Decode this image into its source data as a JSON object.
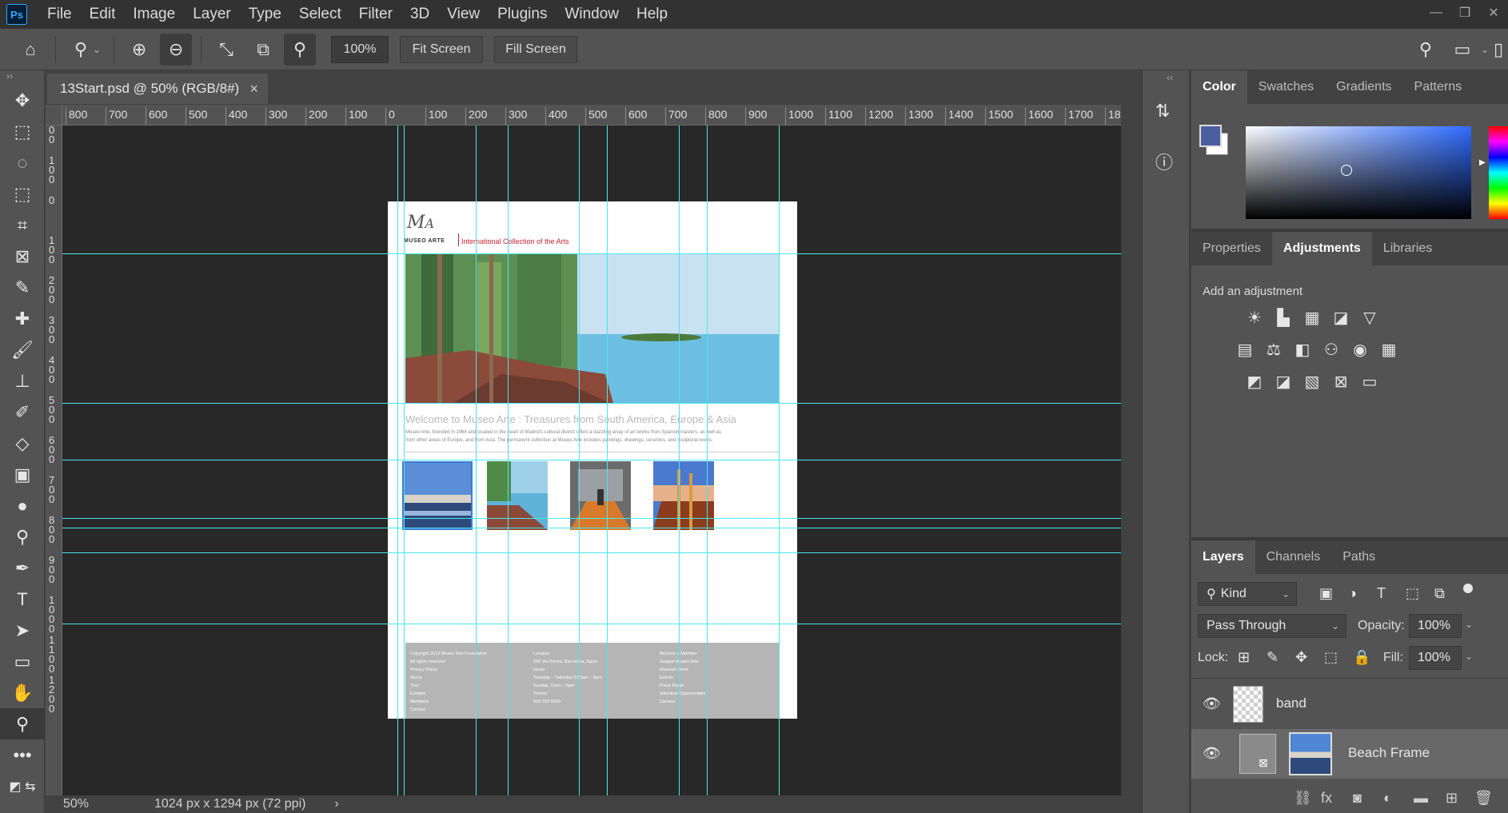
{
  "app": {
    "logo": "Ps"
  },
  "menu": [
    "File",
    "Edit",
    "Image",
    "Layer",
    "Type",
    "Select",
    "Filter",
    "3D",
    "View",
    "Plugins",
    "Window",
    "Help"
  ],
  "options": {
    "zoom_value": "100%",
    "fit_screen": "Fit Screen",
    "fill_screen": "Fill Screen"
  },
  "document": {
    "tab_title": "13Start.psd @ 50% (RGB/8#)",
    "close": "×"
  },
  "ruler_top": [
    "800",
    "700",
    "600",
    "500",
    "400",
    "300",
    "200",
    "100",
    "0",
    "100",
    "200",
    "300",
    "400",
    "500",
    "600",
    "700",
    "800",
    "900",
    "1000",
    "1100",
    "1200",
    "1300",
    "1400",
    "1500",
    "1600",
    "1700",
    "18"
  ],
  "ruler_left": [
    "200",
    "100",
    "0",
    "100",
    "200",
    "300",
    "400",
    "500",
    "600",
    "700",
    "800",
    "900",
    "1000",
    "1100",
    "1200"
  ],
  "status": {
    "zoom": "50%",
    "doc_info": "1024 px x 1294 px (72 ppi)",
    "arrow": "›"
  },
  "artwork": {
    "logo_text": "MUSEO ARTE",
    "tagline": "International Collection of the Arts",
    "welcome": "Welcome to Museo Arte : Treasures from South America, Europe & Asia",
    "body": [
      "Museo Arte, founded in 1964 and located in the heart of Madrid's cultural district offers a dazzling array of art works from Spanish masters, as well as",
      "from other areas of Europe, and from Asia. The permanent collection at Museo Arte includes paintings, drawings, ceramics, and sculptural works."
    ],
    "footer_col1": [
      "Copyright 2012 Museo Arte Foundation",
      "All rights reserved",
      "Privacy Policy",
      "About",
      "Tour",
      "Exhibits",
      "Members",
      "Contact"
    ],
    "footer_col2": [
      "Location",
      "242 Via Bonita, Barcelona, Spain",
      "Hours",
      "Tuesday – Saturday 9:00am – 8pm",
      "Sunday, 11am – 6pm",
      "Tickets",
      "555-555-5555"
    ],
    "footer_col3": [
      "Become a Member",
      "Support Museo Arte",
      "Museum Store",
      "Events",
      "Press Room",
      "Volunteer Opportunities",
      "Careers"
    ]
  },
  "panels": {
    "color_tabs": [
      "Color",
      "Swatches",
      "Gradients",
      "Patterns"
    ],
    "adjust_tabs": [
      "Properties",
      "Adjustments",
      "Libraries"
    ],
    "add_adjustment": "Add an adjustment",
    "layer_tabs": [
      "Layers",
      "Channels",
      "Paths"
    ],
    "kind": "Kind",
    "blend_mode": "Pass Through",
    "opacity_label": "Opacity:",
    "opacity_value": "100%",
    "lock_label": "Lock:",
    "fill_label": "Fill:",
    "fill_value": "100%",
    "layers": [
      "band",
      "Beach Frame"
    ]
  },
  "colors": {
    "guide": "#49e6ee",
    "foreground": "#4a5fa0",
    "background": "#ffffff",
    "picker_hue": "#2f6bff"
  }
}
